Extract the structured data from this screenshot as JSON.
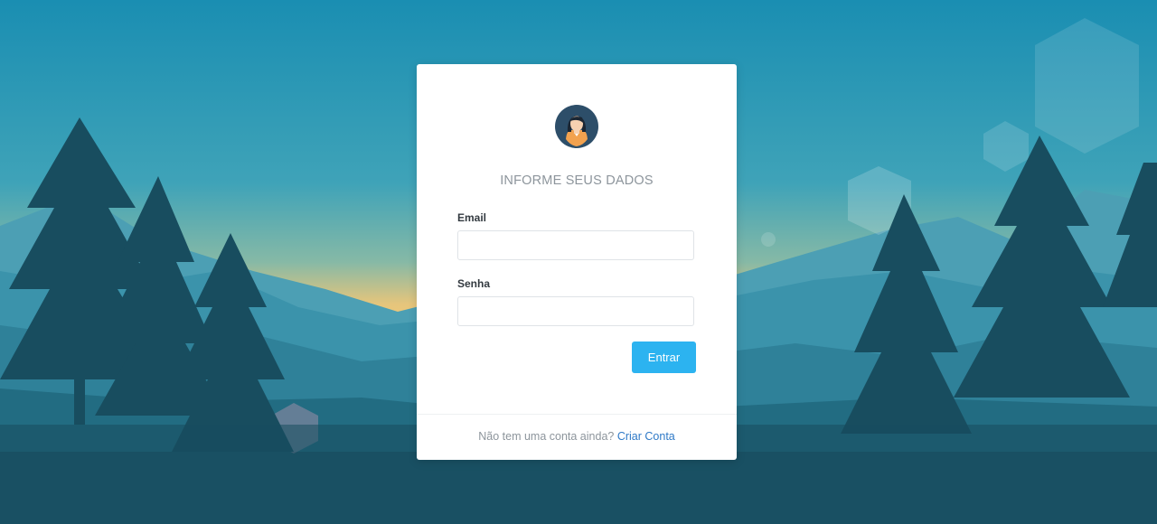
{
  "background": {
    "sky_top": "#1c93b5",
    "horizon": "#f0c878",
    "mountain": "#3d9ab3",
    "trees": "#174a5c"
  },
  "login": {
    "avatar_icon": "woman-avatar-icon",
    "heading": "INFORME SEUS DADOS",
    "email_label": "Email",
    "email_value": "",
    "password_label": "Senha",
    "password_value": "",
    "submit_label": "Entrar",
    "submit_color": "#2cb3f0",
    "footer_text": "Não tem uma conta ainda?",
    "signup_link": "Criar Conta"
  }
}
